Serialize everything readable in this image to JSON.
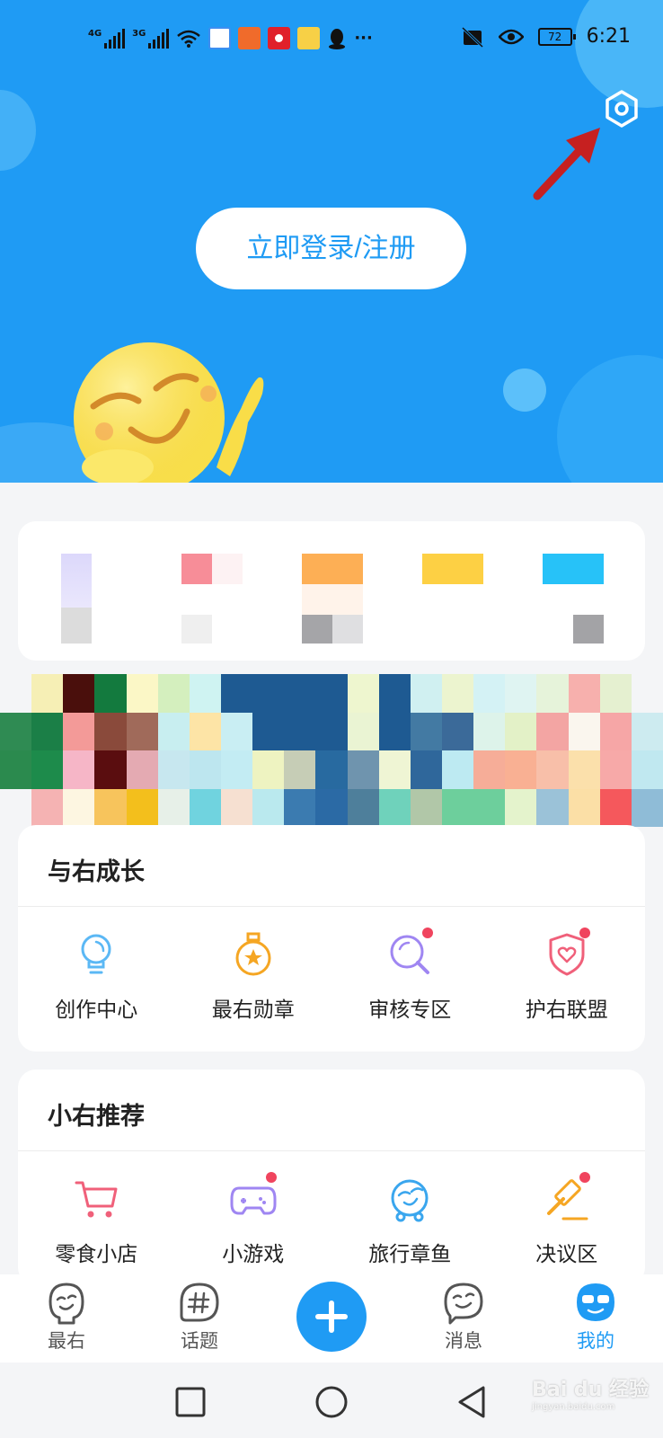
{
  "status_bar": {
    "signal1": "4G",
    "signal2": "3G",
    "battery": "72",
    "time": "6:21",
    "more": "···"
  },
  "header": {
    "login_label": "立即登录/注册"
  },
  "growth": {
    "title": "与右成长",
    "items": [
      {
        "label": "创作中心",
        "icon": "lightbulb-icon",
        "badge": false
      },
      {
        "label": "最右勋章",
        "icon": "medal-icon",
        "badge": false
      },
      {
        "label": "审核专区",
        "icon": "magnifier-icon",
        "badge": true
      },
      {
        "label": "护右联盟",
        "icon": "shield-heart-icon",
        "badge": true
      }
    ]
  },
  "recommend": {
    "title": "小右推荐",
    "items": [
      {
        "label": "零食小店",
        "icon": "cart-icon",
        "badge": false
      },
      {
        "label": "小游戏",
        "icon": "gamepad-icon",
        "badge": true
      },
      {
        "label": "旅行章鱼",
        "icon": "octopus-icon",
        "badge": false
      },
      {
        "label": "决议区",
        "icon": "gavel-icon",
        "badge": true
      }
    ]
  },
  "bottom_nav": {
    "items": [
      {
        "label": "最右"
      },
      {
        "label": "话题"
      },
      {
        "label": "消息"
      },
      {
        "label": "我的"
      }
    ]
  },
  "watermark": {
    "brand": "Bai du 经验",
    "url": "jingyan.baidu.com"
  },
  "colors": {
    "primary": "#1f9bf4",
    "badge": "#f0445e",
    "arrow": "#c62020"
  }
}
